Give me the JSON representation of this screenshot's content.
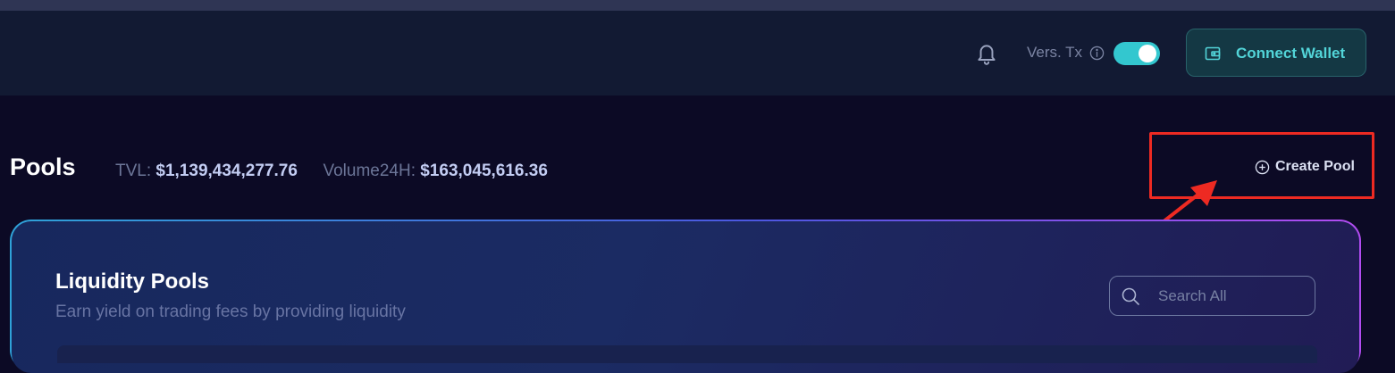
{
  "header": {
    "vers_label": "Vers. Tx",
    "toggle_on": true,
    "connect_label": "Connect Wallet",
    "icons": [
      "bell-icon",
      "info-icon",
      "wallet-icon"
    ]
  },
  "pools": {
    "title": "Pools",
    "tvl_label": "TVL:",
    "tvl_value": "$1,139,434,277.76",
    "volume_label": "Volume24H:",
    "volume_value": "$163,045,616.36",
    "create_label": "Create Pool"
  },
  "card": {
    "title": "Liquidity Pools",
    "subtitle": "Earn yield on trading fees by providing liquidity",
    "search_placeholder": "Search All"
  },
  "colors": {
    "accent": "#33c7cf",
    "highlight": "#ee2a22",
    "background": "#0c0a25"
  }
}
